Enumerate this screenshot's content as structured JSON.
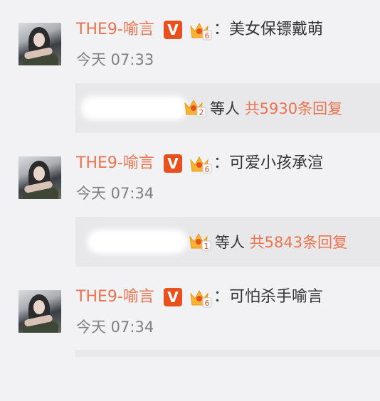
{
  "comments": [
    {
      "user": "THE9-喻言",
      "colon": "：",
      "text": "美女保镖戴萌",
      "time": "今天 07:33",
      "reply": {
        "people": "等人",
        "count": "共5930条回复",
        "fan_level": "2"
      }
    },
    {
      "user": "THE9-喻言",
      "colon": "：",
      "text": "可爱小孩承渲",
      "time": "今天 07:34",
      "reply": {
        "people": "等人",
        "count": "共5843条回复",
        "fan_level": "1"
      }
    },
    {
      "user": "THE9-喻言",
      "colon": "：",
      "text": "可怕杀手喻言",
      "time": "今天 07:34"
    }
  ],
  "badges": {
    "verified": "V",
    "crown_level": "6"
  },
  "colors": {
    "accent": "#eb7350",
    "verified": "#e8501e",
    "text": "#333333",
    "muted": "#808080",
    "bg": "#f2f2f4",
    "reply_bg": "#e8e8ea"
  }
}
